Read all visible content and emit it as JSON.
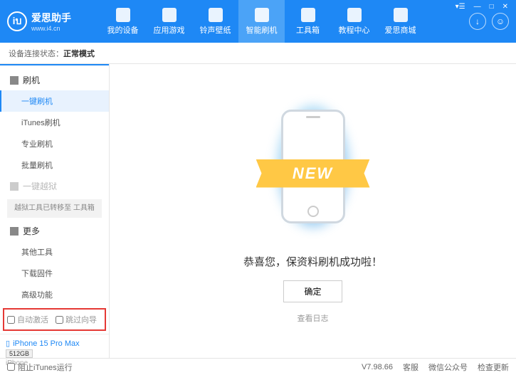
{
  "app": {
    "name": "爱思助手",
    "url": "www.i4.cn"
  },
  "nav": {
    "items": [
      "我的设备",
      "应用游戏",
      "铃声壁纸",
      "智能刷机",
      "工具箱",
      "教程中心",
      "爱思商城"
    ],
    "activeIndex": 3
  },
  "status": {
    "label": "设备连接状态：",
    "value": "正常模式"
  },
  "sidebar": {
    "flash": {
      "title": "刷机",
      "items": [
        "一键刷机",
        "iTunes刷机",
        "专业刷机",
        "批量刷机"
      ],
      "activeIndex": 0
    },
    "jailbreak": {
      "title": "一键越狱",
      "note": "越狱工具已转移至\n工具箱"
    },
    "more": {
      "title": "更多",
      "items": [
        "其他工具",
        "下载固件",
        "高级功能"
      ]
    },
    "checkboxes": {
      "autoActivate": "自动激活",
      "skipGuide": "跳过向导"
    },
    "device": {
      "name": "iPhone 15 Pro Max",
      "storage": "512GB",
      "type": "iPhone"
    }
  },
  "main": {
    "ribbon": "NEW",
    "successText": "恭喜您，保资料刷机成功啦！",
    "confirmBtn": "确定",
    "logLink": "查看日志"
  },
  "footer": {
    "blockItunes": "阻止iTunes运行",
    "version": "V7.98.66",
    "links": [
      "客服",
      "微信公众号",
      "检查更新"
    ]
  }
}
